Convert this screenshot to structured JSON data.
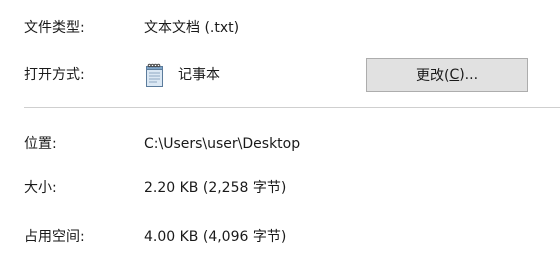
{
  "file_type": {
    "label": "文件类型:",
    "value": "文本文档 (.txt)"
  },
  "opens_with": {
    "label": "打开方式:",
    "app_icon": "notepad-icon",
    "app_name": "记事本",
    "change_button": {
      "text_before": "更改(",
      "mnemonic": "C",
      "text_after": ")..."
    }
  },
  "location": {
    "label": "位置:",
    "value": "C:\\Users\\user\\Desktop"
  },
  "size": {
    "label": "大小:",
    "value": "2.20 KB (2,258 字节)"
  },
  "size_on_disk": {
    "label": "占用空间:",
    "value": "4.00 KB (4,096 字节)"
  },
  "colors": {
    "button_bg": "#e1e1e1",
    "button_border": "#adadad",
    "divider": "#cfcfcf",
    "text": "#1a1a1a"
  }
}
